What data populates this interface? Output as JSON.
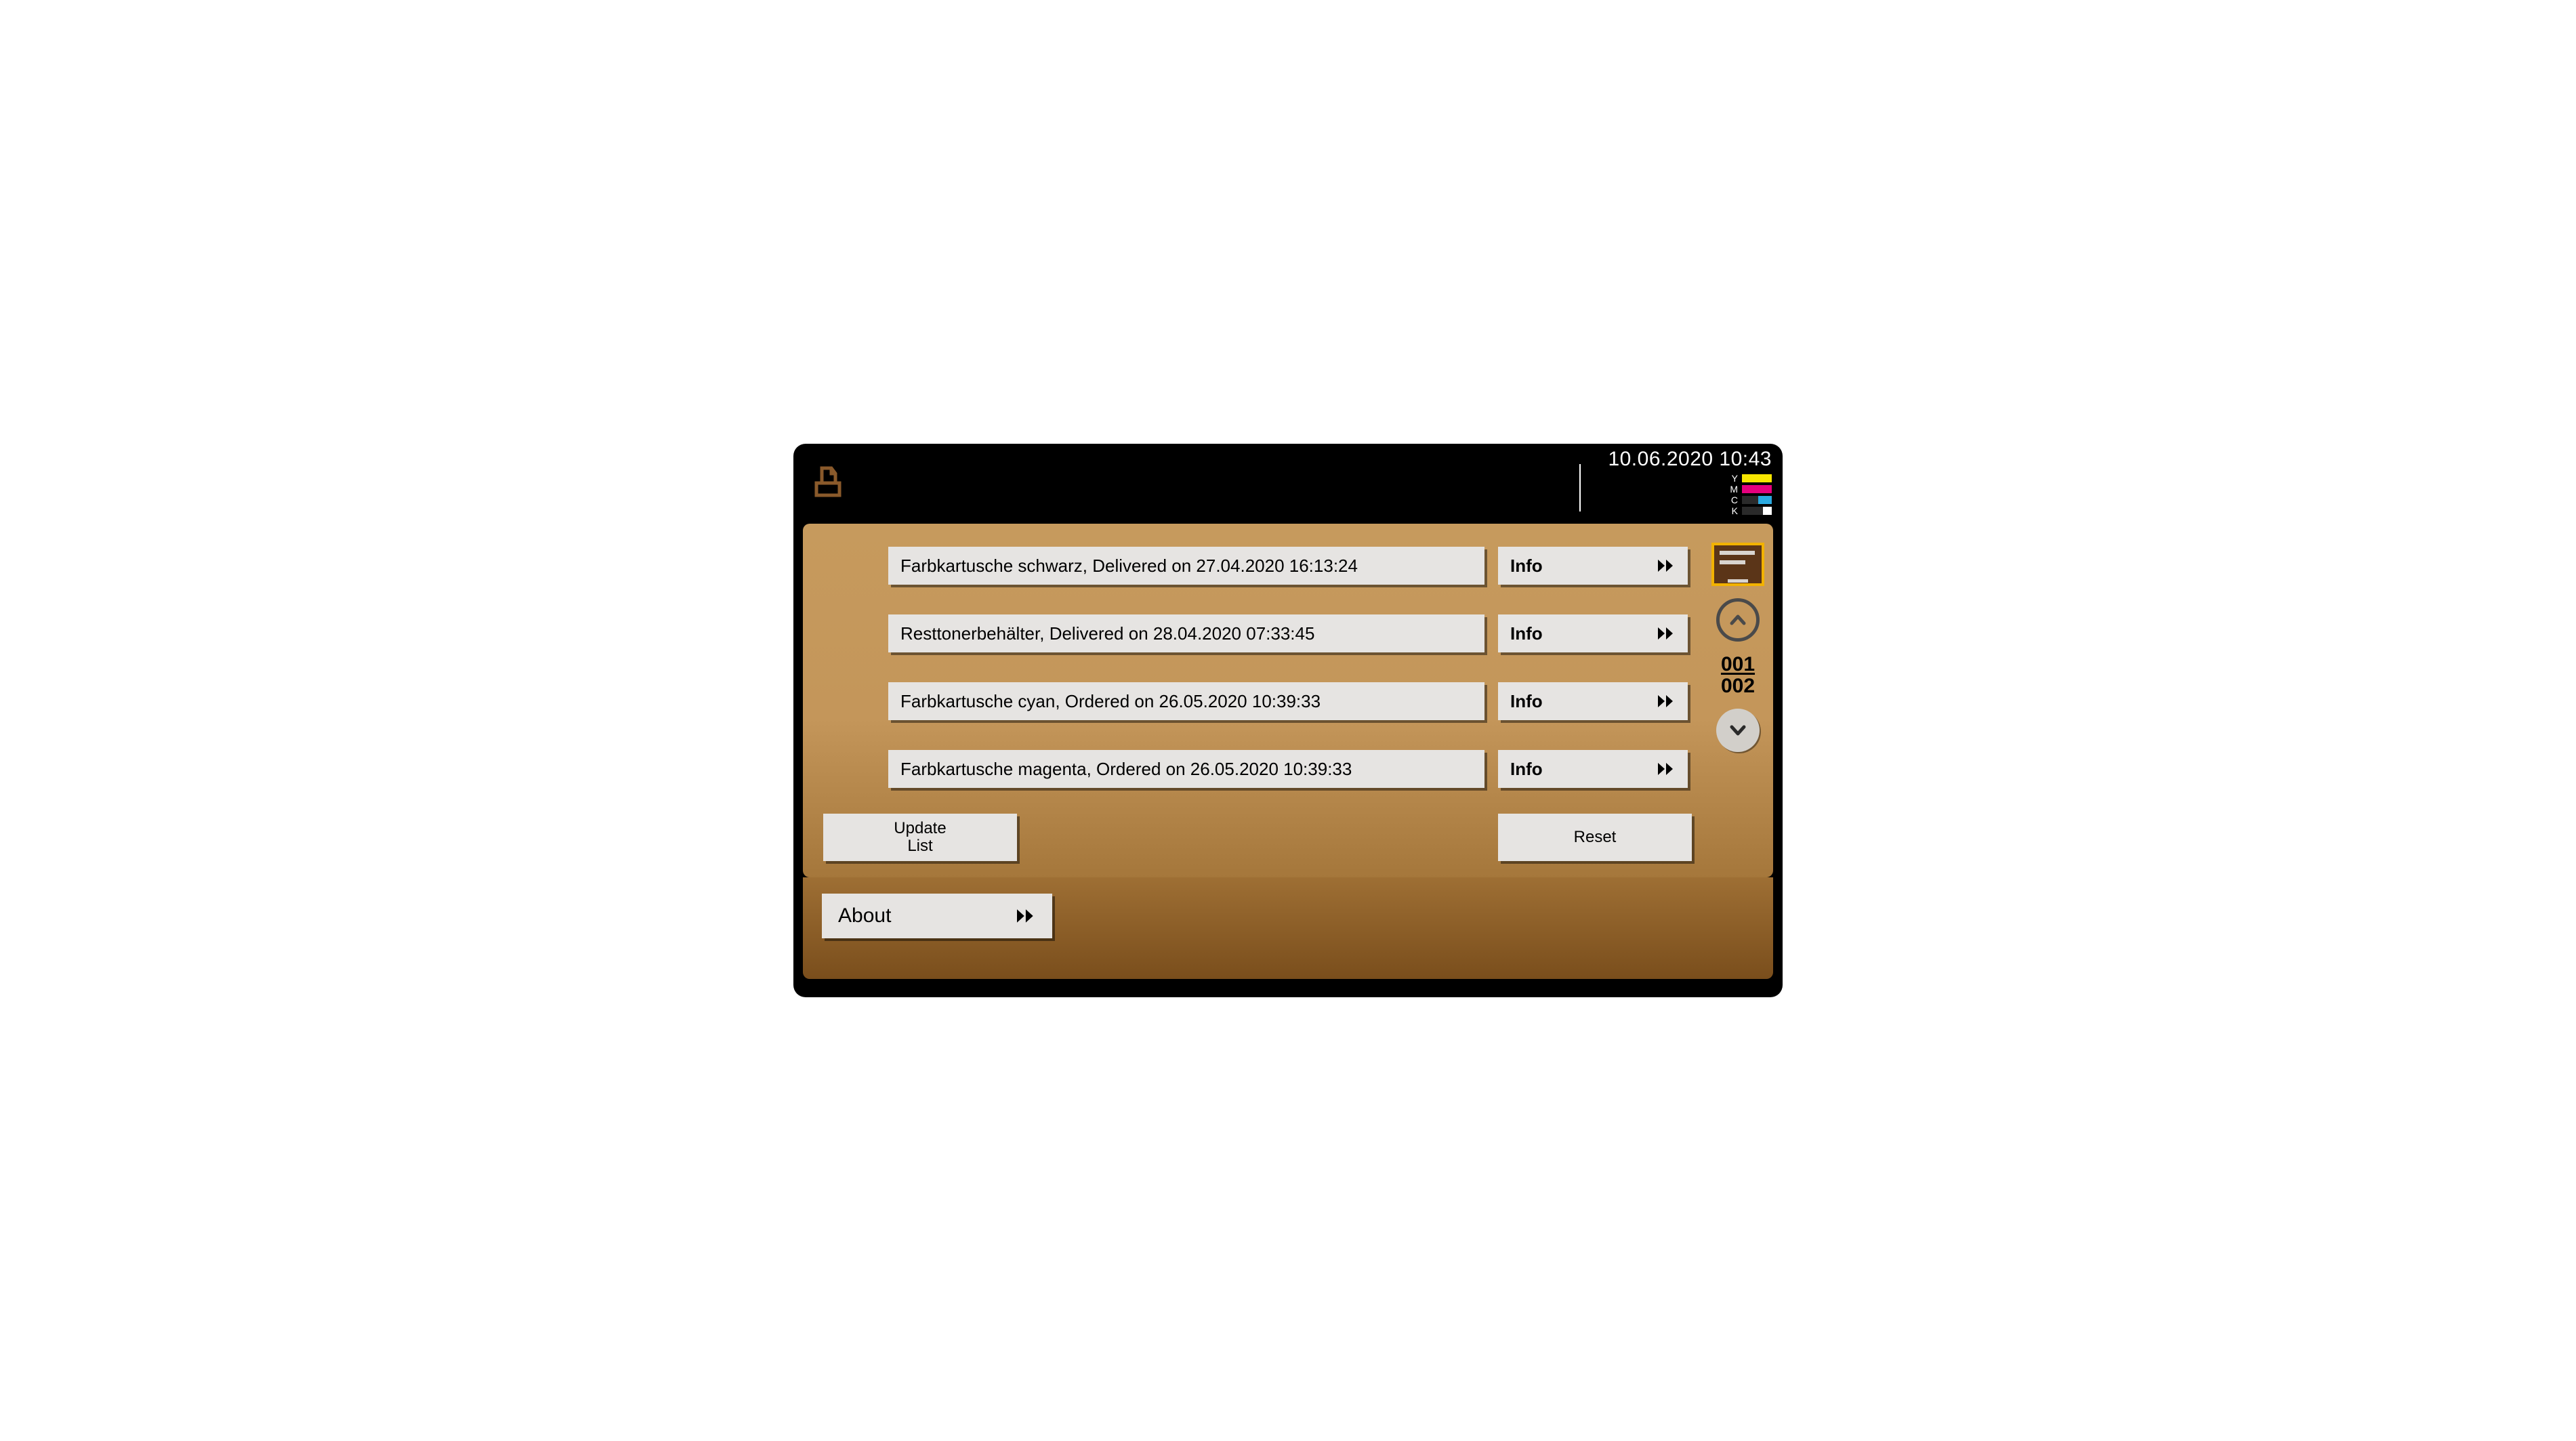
{
  "header": {
    "datetime": "10.06.2020 10:43",
    "toner": [
      {
        "label": "Y",
        "color": "#f7e600",
        "level": 1.0
      },
      {
        "label": "M",
        "color": "#e6007e",
        "level": 1.0
      },
      {
        "label": "C",
        "color": "#2aa9e0",
        "level": 0.45
      },
      {
        "label": "K",
        "color": "#ffffff",
        "level": 0.3
      }
    ]
  },
  "list": {
    "items": [
      {
        "text": "Farbkartusche schwarz, Delivered on 27.04.2020 16:13:24",
        "info_label": "Info"
      },
      {
        "text": "Resttonerbehälter, Delivered on 28.04.2020 07:33:45",
        "info_label": "Info"
      },
      {
        "text": "Farbkartusche cyan, Ordered on 26.05.2020 10:39:33",
        "info_label": "Info"
      },
      {
        "text": "Farbkartusche magenta, Ordered on 26.05.2020 10:39:33",
        "info_label": "Info"
      }
    ]
  },
  "actions": {
    "update_line1": "Update",
    "update_line2": "List",
    "reset": "Reset"
  },
  "pager": {
    "current": "001",
    "total": "002"
  },
  "footer": {
    "about": "About"
  }
}
